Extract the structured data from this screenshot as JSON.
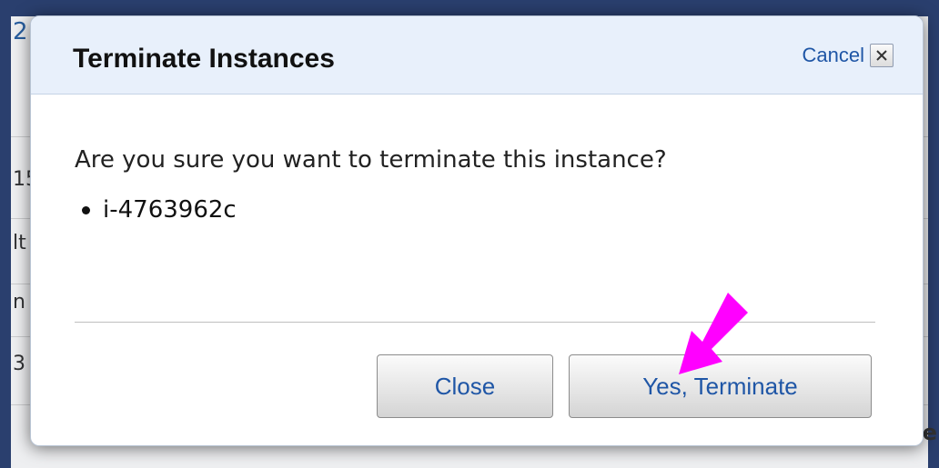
{
  "background": {
    "fragments": [
      "2",
      "15",
      "lt",
      "n",
      "3",
      "e"
    ]
  },
  "dialog": {
    "title": "Terminate Instances",
    "cancel_label": "Cancel",
    "message": "Are you sure you want to terminate this instance?",
    "instances": [
      "i-4763962c"
    ],
    "buttons": {
      "close_label": "Close",
      "terminate_label": "Yes, Terminate"
    }
  },
  "colors": {
    "header_bg": "#e8f0fb",
    "link": "#1f56a6",
    "annotation_arrow": "#ff00ff",
    "backdrop": "#2a3f6e"
  },
  "icons": {
    "close": "close-icon",
    "annotation": "pointer-arrow-icon"
  }
}
